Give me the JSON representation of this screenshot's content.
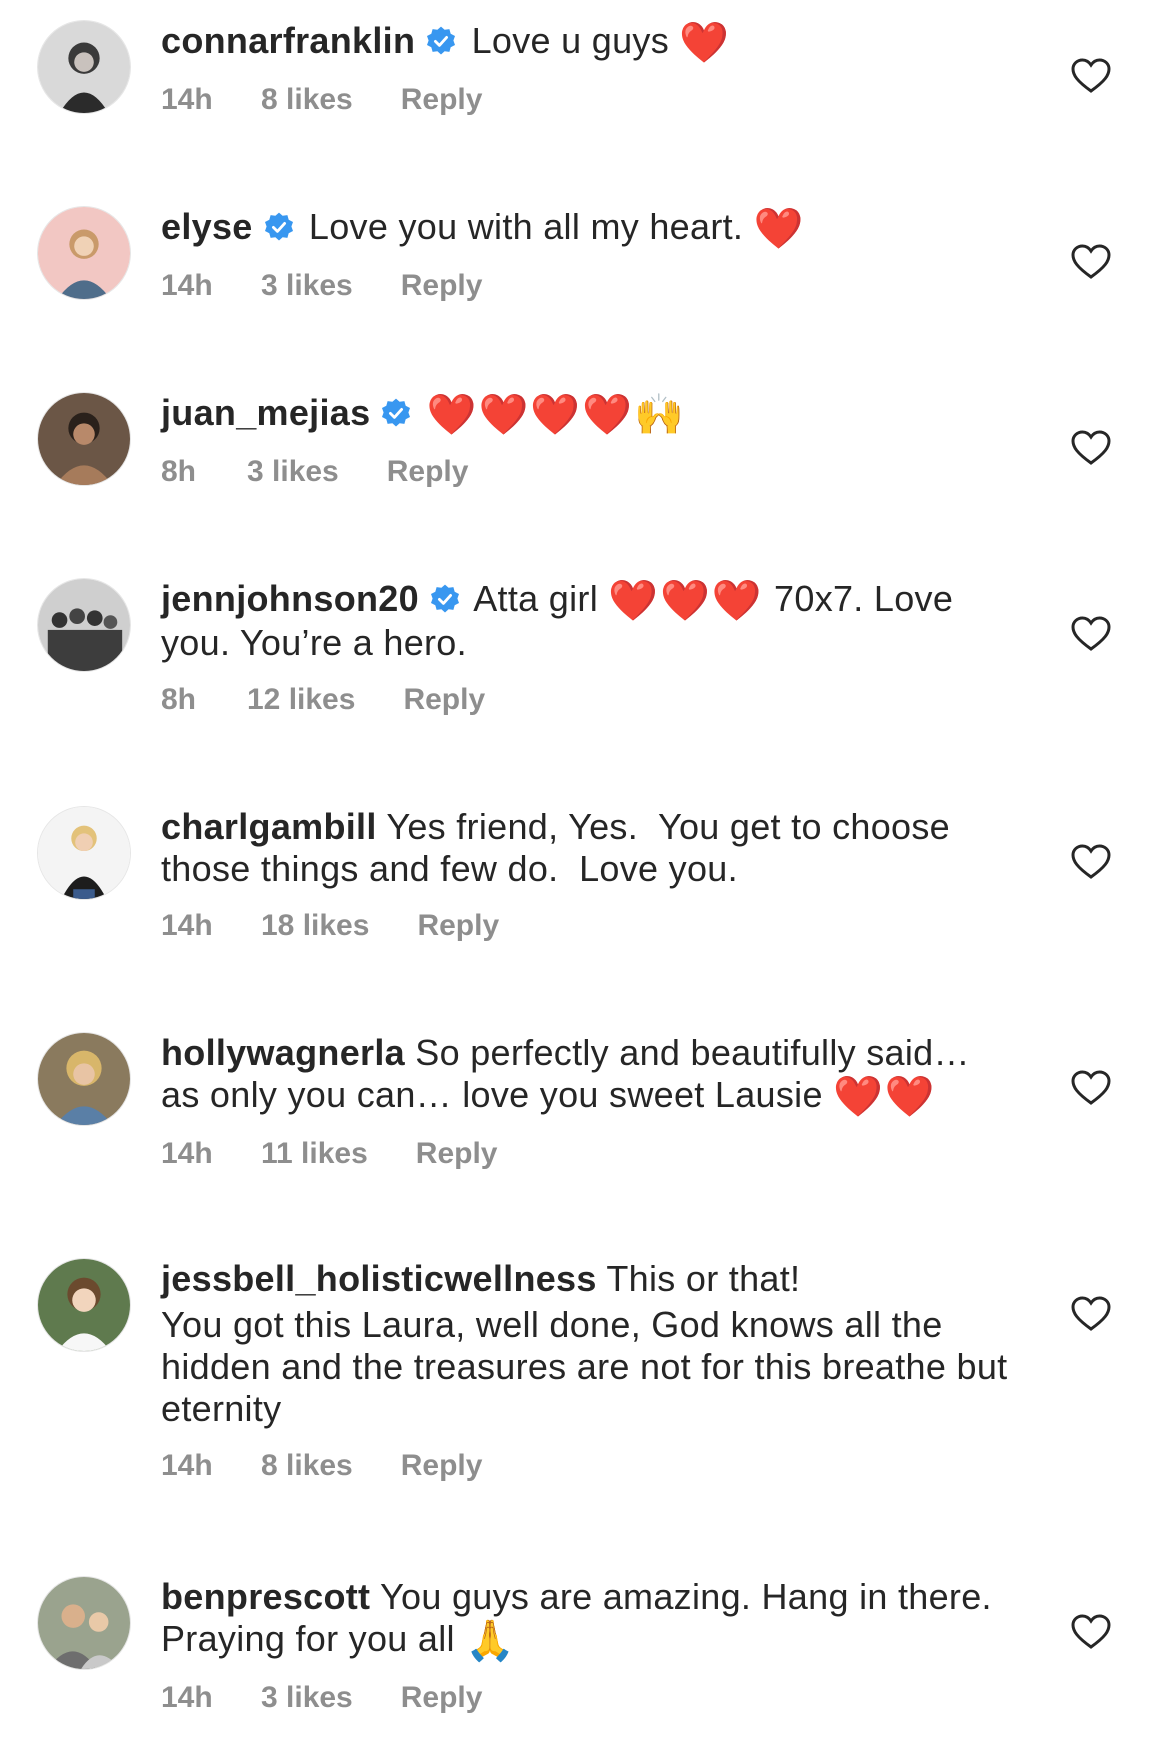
{
  "comments": [
    {
      "username": "connarfranklin",
      "verified": true,
      "text": "Love u guys",
      "emoji_after": "❤️",
      "time": "14h",
      "likes": "8 likes",
      "reply": "Reply"
    },
    {
      "username": "elyse",
      "verified": true,
      "text": "Love you with all my heart.",
      "emoji_after": "❤️",
      "time": "14h",
      "likes": "3 likes",
      "reply": "Reply"
    },
    {
      "username": "juan_mejias",
      "verified": true,
      "text": "",
      "emoji_hearts": "❤️❤️❤️❤️",
      "emoji_hands": "🙌",
      "time": "8h",
      "likes": "3 likes",
      "reply": "Reply"
    },
    {
      "username": "jennjohnson20",
      "verified": true,
      "text_before": "Atta girl",
      "emoji_mid": "❤️❤️❤️",
      "text_after": "70x7. Love you. You’re a hero.",
      "time": "8h",
      "likes": "12 likes",
      "reply": "Reply"
    },
    {
      "username": "charlgambill",
      "verified": false,
      "text": "Yes friend, Yes.  You get to choose those things and few do.  Love you.",
      "time": "14h",
      "likes": "18 likes",
      "reply": "Reply"
    },
    {
      "username": "hollywagnerla",
      "verified": false,
      "text": "So perfectly and beautifully said… as only you can… love you sweet Lausie",
      "emoji_after": "❤️❤️",
      "time": "14h",
      "likes": "11 likes",
      "reply": "Reply"
    },
    {
      "username": "jessbell_holisticwellness",
      "verified": false,
      "text": "This or that!",
      "text_line2": "You got this Laura, well done, God knows all the hidden and the treasures are not for this breathe but eternity",
      "time": "14h",
      "likes": "8 likes",
      "reply": "Reply"
    },
    {
      "username": "benprescott",
      "verified": false,
      "text": "You guys are amazing. Hang in there. Praying for you all",
      "emoji_after": "🙏",
      "time": "14h",
      "likes": "3 likes",
      "reply": "Reply"
    }
  ],
  "icons": {
    "like": "heart-outline-icon",
    "verified": "verified-badge-icon"
  },
  "colors": {
    "text": "#262626",
    "meta": "#8e8e8e",
    "verified": "#3897f0",
    "heart_emoji": "#e0111f"
  }
}
